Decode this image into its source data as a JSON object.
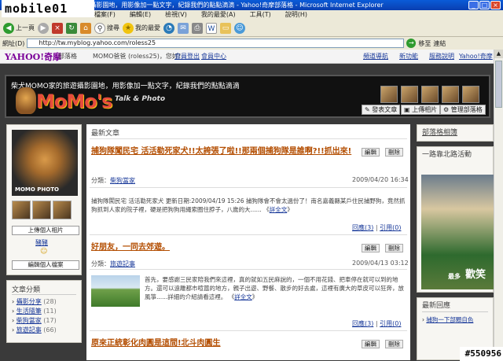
{
  "watermark": "mobile01",
  "corner_tag": "#550956",
  "window": {
    "title": "柴犬MOMO家的旅遊攝影園地，用影像加一點文字，紀錄我們的點點滴滴 - Yahoo!奇摩部落格 - Microsoft Internet Explorer"
  },
  "menu": [
    "檔案(F)",
    "編輯(E)",
    "檢視(V)",
    "我的最愛(A)",
    "工具(T)",
    "說明(H)"
  ],
  "toolbar": {
    "back": "上一頁",
    "search": "搜尋",
    "favorites": "我的最愛"
  },
  "address": {
    "label": "網址(D)",
    "url": "http://tw.myblog.yahoo.com/roless25",
    "go": "移至",
    "links": "連結"
  },
  "yahoo_bar": {
    "logo": "YAHOO!奇摩",
    "section": "部落格",
    "greeting": "MOMO爸爸 (roless25)，您好！",
    "login": "會員登出",
    "account": "會員中心",
    "right_links": [
      "頻道導航",
      "新功能",
      "服務說明",
      "Yahoo!奇摩"
    ]
  },
  "banner": {
    "text": "柴犬MOMO家的旅遊攝影園地，用影像加一點文字，紀錄我們的點點滴滴",
    "logo": "MoMo's",
    "tagline": "Talk & Photo",
    "buttons": [
      "發表文章",
      "上傳相片",
      "管理部落格"
    ]
  },
  "left": {
    "avatar_caption": "MOMO PHOTO",
    "upload_btn": "上傳個人相片",
    "name": "豬豬",
    "edit_btn": "編輯個人檔案",
    "categories_title": "文章分類",
    "categories": [
      {
        "name": "攝影分享",
        "count": "(28)"
      },
      {
        "name": "生活隨筆",
        "count": "(11)"
      },
      {
        "name": "柴狗當家",
        "count": "(17)"
      },
      {
        "name": "旅遊記事",
        "count": "(66)"
      }
    ]
  },
  "center": {
    "section_title": "最新文章",
    "edit": "編輯",
    "delete": "刪除",
    "posts": [
      {
        "title": "捕狗隊闖民宅 活活勒死家犬!!太誇張了啦!!那兩個捕狗隊是誰啊?!!抓出來!",
        "category_label": "分類：",
        "category": "柴狗當家",
        "date": "2009/04/20 16:34",
        "body": "捕狗隊闖民宅 活活勒死家犬 更新日期:2009/04/19 15:26 捕狗隊會不會太過份了！南名嘉義縣某戶住民捕野狗，竟然抓狗抓到人家的院子裡，硬是把狗狗用繩索圈住脖子，八歲的大......",
        "more": "詳全文",
        "comments": "回應(3)",
        "trackback": "引用(0)"
      },
      {
        "title": "好朋友，一同去郊遊。",
        "category_label": "分類：",
        "category": "旅遊記事",
        "date": "2009/04/13 03:12",
        "body": "首先，要感謝三民家陪我們來這裡，真的就如五民麻說的，一個不用花錢、把車停在就可以到的地方。還可以遠離都市喧囂的地方，親子出遊、野餐、散步的好去處，這裡有廣大的草皮可以狂奔，放風箏......詳細的介紹請看這裡。",
        "more": "詳全文",
        "comments": "回應(3)",
        "trackback": "引用(0)"
      },
      {
        "title": "原來正統彰化肉圓是這間!北斗肉圓生",
        "category_label": "",
        "category": "",
        "date": "",
        "body": "",
        "more": "",
        "comments": "",
        "trackback": ""
      }
    ]
  },
  "right": {
    "album_title": "部落格相簿",
    "event_title": "一路靠北路活動",
    "photo_text": "歡笑",
    "photo_sub": "最多",
    "recent_title": "最新回應",
    "recent_item": "捕狗一下部顆自色"
  }
}
